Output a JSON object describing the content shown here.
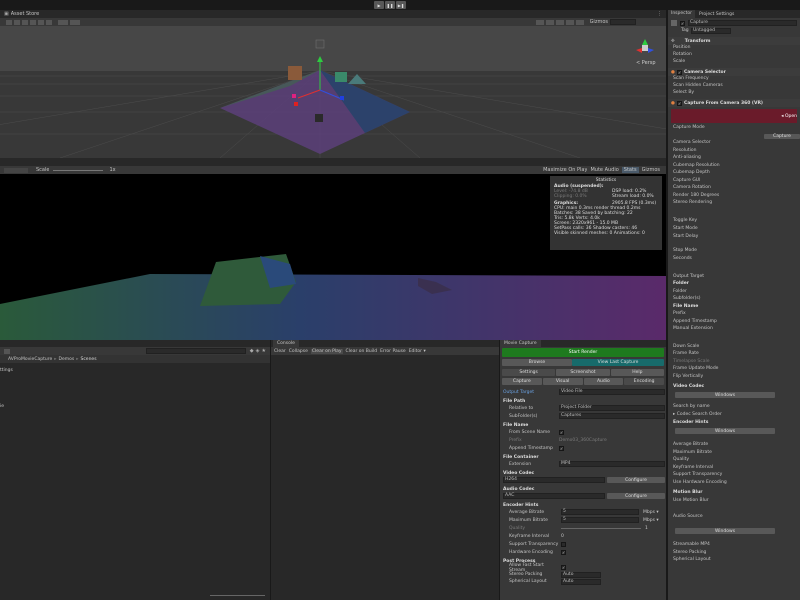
{
  "topbar": {
    "asset_store": "Asset Store",
    "play": "▶",
    "pause": "❚❚",
    "step": "▶❚"
  },
  "scene_view": {
    "gizmos": "Gizmos",
    "persp": "< Persp"
  },
  "game_toolbar": {
    "scale_label": "Scale",
    "scale_value": "1x",
    "maximize": "Maximize On Play",
    "mute": "Mute Audio",
    "stats": "Stats",
    "gizmos": "Gizmos"
  },
  "stats": {
    "title": "Statistics",
    "audio_header": "Audio (suspended):",
    "level": "Level: -74.8 dB",
    "clipping": "Clipping: 0.0%",
    "dsp": "DSP load: 0.2%",
    "stream": "Stream load: 0.0%",
    "graphics_header": "Graphics:",
    "fps": "2905.8 FPS (0.3ms)",
    "lines": [
      "CPU: main 0.3ms  render thread 0.2ms",
      "Batches: 38    Saved by batching: 22",
      "Tris: 5.8k     Verts: 4.0k",
      "Screen: 2320x961 - 15.0 MB",
      "SetPass calls: 36   Shadow casters: 46",
      "Visible skinned meshes: 0  Animations: 0"
    ]
  },
  "project": {
    "path": [
      "AVProMovieCapture",
      "Demos",
      "Scenes"
    ],
    "side_items": [
      "ttings",
      "ie"
    ]
  },
  "console": {
    "tab": "Console",
    "buttons": [
      "Clear",
      "Collapse",
      "Clear on Play",
      "Clear on Build",
      "Error Pause",
      "Editor ▾"
    ]
  },
  "movie_capture": {
    "tab": "Movie Capture",
    "start": "Start Render",
    "browse": "Browse",
    "view_last": "View Last Capture",
    "tabs1": [
      "Settings",
      "Screenshot",
      "Help"
    ],
    "tabs2": [
      "Capture",
      "Visual",
      "Audio",
      "Encoding"
    ],
    "output_target_label": "Output Target",
    "output_target_value": "Video File",
    "file_path": "File Path",
    "relative_to": "Relative to",
    "relative_value": "Project Folder",
    "subfolder": "SubFolder(s)",
    "subfolder_value": "Captures",
    "file_name": "File Name",
    "from_scene": "From Scene Name",
    "prefix": "Prefix",
    "prefix_value": "Demo03_360Capture",
    "append_ts": "Append Timestamp",
    "file_container": "File Container",
    "extension": "Extension",
    "extension_value": "MP4",
    "video_codec": "Video Codec",
    "video_codec_value": "H264",
    "configure": "Configure",
    "audio_codec": "Audio Codec",
    "audio_codec_value": "AAC",
    "encoder_hints": "Encoder Hints",
    "avg_bitrate": "Average Bitrate",
    "avg_val": "5",
    "max_bitrate": "Maximum Bitrate",
    "max_val": "5",
    "unit": "Mbps ▾",
    "quality": "Quality",
    "quality_val": "1",
    "keyframe": "Keyframe Interval",
    "keyframe_val": "0",
    "transparency": "Support Transparency",
    "hw_enc": "Hardware Encoding",
    "post": "Post Process",
    "fast_start": "Allow Fast Start Stream",
    "stereo_pack": "Stereo Packing",
    "stereo_pack_val": "Auto",
    "sph_layout": "Spherical Layout",
    "sph_val": "Auto"
  },
  "inspector": {
    "tab1": "Inspector",
    "tab2": "Project Settings",
    "object_name": "Capture",
    "tag_label": "Tag",
    "tag_value": "Untagged",
    "transform": "Transform",
    "position": "Position",
    "rotation": "Rotation",
    "scale": "Scale",
    "camera_selector": "Camera Selector",
    "scan_freq": "Scan Frequency",
    "scan_hidden": "Scan Hidden Cameras",
    "select_by": "Select By",
    "capture_360": "Capture From Camera 360 (VR)",
    "open_btn": "◂ Open",
    "capture_mode": "Capture Mode",
    "capture_btn": "Capture",
    "props1": [
      "Camera Selector",
      "Resolution",
      "Anti-aliasing",
      "Cubemap Resolution",
      "Cubemap Depth",
      "Capture GUI",
      "Camera Rotation",
      "Render 180 Degrees",
      "Stereo Rendering"
    ],
    "props2": [
      "Toggle Key",
      "Start Mode",
      "Start Delay"
    ],
    "props3": [
      "Stop Mode",
      "Seconds"
    ],
    "props4": [
      "Output Target",
      "Folder",
      "Folder",
      "Subfolder(s)",
      "File Name",
      "Prefix",
      "Append Timestamp",
      "Manual Extension"
    ],
    "props5": [
      "Down Scale",
      "Frame Rate",
      "Timelapse Scale",
      "Frame Update Mode",
      "Flip Vertically"
    ],
    "video_codec": "Video Codec",
    "windows": "Windows",
    "search_by": "Search by name",
    "codec_order": "▸ Codec Search Order",
    "encoder_hints": "Encoder Hints",
    "props6": [
      "Average Bitrate",
      "Maximum Bitrate",
      "Quality",
      "Keyframe Interval",
      "Support Transparency",
      "Use Hardware Encoding"
    ],
    "motion_blur": "Motion Blur",
    "use_motion_blur": "Use Motion Blur",
    "audio_source": "Audio Source",
    "props7": [
      "Streamable MP4",
      "Stereo Packing",
      "Spherical Layout"
    ]
  },
  "colors": {
    "green": "#1e7a1e",
    "teal": "#176b6b",
    "blue": "#3a72b0",
    "red_banner": "#6a1b2a"
  }
}
